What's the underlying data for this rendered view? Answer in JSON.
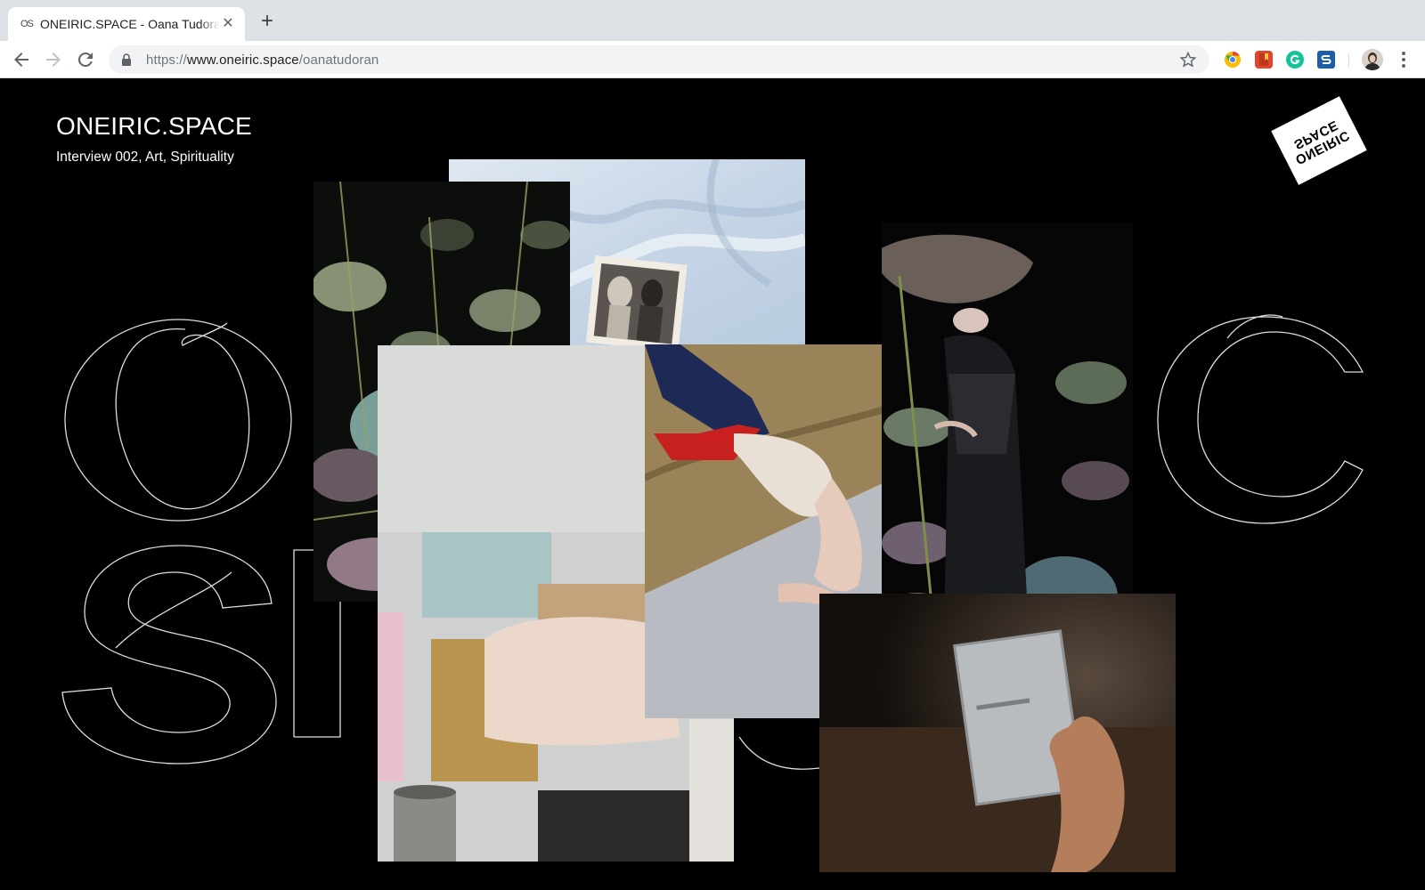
{
  "browser": {
    "tab": {
      "favicon": "OS",
      "title": "ONEIRIC.SPACE - Oana Tudoran",
      "close": "✕"
    },
    "new_tab": "+",
    "url": {
      "scheme": "https://",
      "host": "www.oneiric.space",
      "path": "/oanatudoran"
    }
  },
  "page": {
    "brand": "ONEIRIC.SPACE",
    "subtitle": "Interview 002, Art, Spirituality",
    "sticker": {
      "line1": "SPACE",
      "line2": "ONEIRIC"
    },
    "background_letters": [
      "O",
      "C",
      "S",
      "P"
    ]
  },
  "colors": {
    "background": "#000000",
    "text": "#ffffff",
    "tabbar": "#dee1e6",
    "omnibox": "#f1f3f4"
  }
}
